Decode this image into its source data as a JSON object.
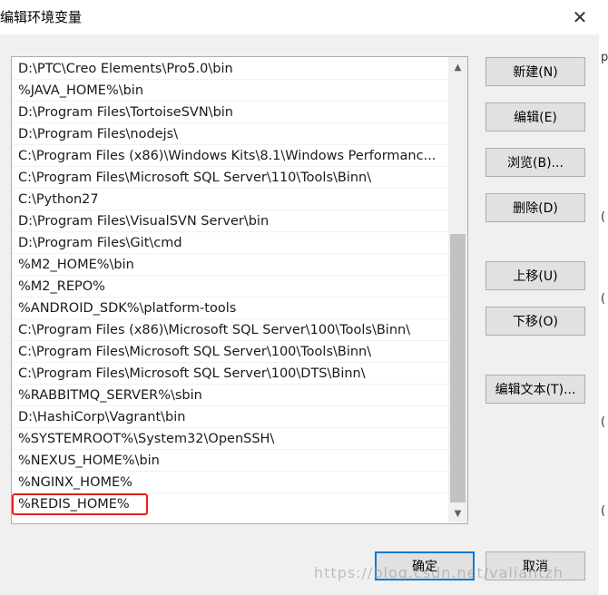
{
  "window": {
    "title": "编辑环境变量",
    "close_glyph": "✕"
  },
  "list": {
    "items": [
      "D:\\PTC\\Creo Elements\\Pro5.0\\bin",
      "%JAVA_HOME%\\bin",
      "D:\\Program Files\\TortoiseSVN\\bin",
      "D:\\Program Files\\nodejs\\",
      "C:\\Program Files (x86)\\Windows Kits\\8.1\\Windows Performanc...",
      "C:\\Program Files\\Microsoft SQL Server\\110\\Tools\\Binn\\",
      "C:\\Python27",
      "D:\\Program Files\\VisualSVN Server\\bin",
      "D:\\Program Files\\Git\\cmd",
      "%M2_HOME%\\bin",
      "%M2_REPO%",
      "%ANDROID_SDK%\\platform-tools",
      "C:\\Program Files (x86)\\Microsoft SQL Server\\100\\Tools\\Binn\\",
      "C:\\Program Files\\Microsoft SQL Server\\100\\Tools\\Binn\\",
      "C:\\Program Files\\Microsoft SQL Server\\100\\DTS\\Binn\\",
      "%RABBITMQ_SERVER%\\sbin",
      "D:\\HashiCorp\\Vagrant\\bin",
      "%SYSTEMROOT%\\System32\\OpenSSH\\",
      "%NEXUS_HOME%\\bin",
      "%NGINX_HOME%",
      "%REDIS_HOME%"
    ],
    "highlighted_index": 20,
    "highlight_color": "#e3211c"
  },
  "scrollbar": {
    "up_glyph": "▲",
    "down_glyph": "▼",
    "up_icon": "chevron-up-icon",
    "down_icon": "chevron-down-icon"
  },
  "buttons": {
    "new": "新建(N)",
    "edit": "编辑(E)",
    "browse": "浏览(B)...",
    "delete": "删除(D)",
    "move_up": "上移(U)",
    "move_down": "下移(O)",
    "edit_text": "编辑文本(T)...",
    "ok": "确定",
    "cancel": "取消"
  },
  "background_window": {
    "glyphs": [
      "p",
      "(",
      "(",
      "(",
      "("
    ]
  },
  "watermark": "https://blog.csdn.net/valiantzh",
  "colors": {
    "accent": "#0078d7",
    "button_bg": "#e1e1e1",
    "dialog_bg": "#f0f0f0"
  }
}
